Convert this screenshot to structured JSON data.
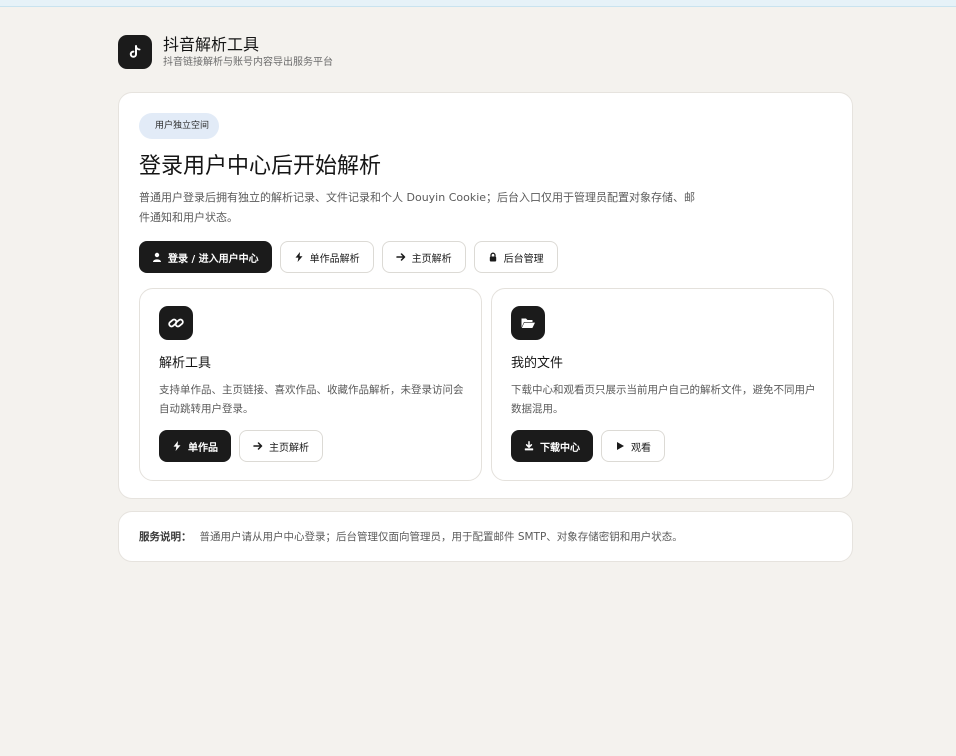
{
  "app": {
    "title": "抖音解析工具",
    "subtitle": "抖音链接解析与账号内容导出服务平台",
    "logo_icon": "tiktok-note-icon"
  },
  "hero": {
    "badge": "用户独立空间",
    "heading": "登录用户中心后开始解析",
    "description": "普通用户登录后拥有独立的解析记录、文件记录和个人 Douyin Cookie；后台入口仅用于管理员配置对象存储、邮件通知和用户状态。",
    "buttons": [
      {
        "label": "登录 / 进入用户中心",
        "icon": "user-icon"
      },
      {
        "label": "单作品解析",
        "icon": "bolt-icon"
      },
      {
        "label": "主页解析",
        "icon": "arrow-right-icon"
      },
      {
        "label": "后台管理",
        "icon": "lock-icon"
      }
    ]
  },
  "cards": [
    {
      "icon": "link-icon",
      "title": "解析工具",
      "description": "支持单作品、主页链接、喜欢作品、收藏作品解析，未登录访问会自动跳转用户登录。",
      "buttons": [
        {
          "label": "单作品",
          "icon": "bolt-icon"
        },
        {
          "label": "主页解析",
          "icon": "arrow-right-icon"
        }
      ]
    },
    {
      "icon": "folder-open-icon",
      "title": "我的文件",
      "description": "下载中心和观看页只展示当前用户自己的解析文件，避免不同用户数据混用。",
      "buttons": [
        {
          "label": "下载中心",
          "icon": "download-icon"
        },
        {
          "label": "观看",
          "icon": "play-icon"
        }
      ]
    }
  ],
  "notice": {
    "label": "服务说明：",
    "text": "普通用户请从用户中心登录；后台管理仅面向管理员，用于配置邮件 SMTP、对象存储密钥和用户状态。"
  },
  "colors": {
    "background": "#f4f2ee",
    "dark": "#1b1b1b",
    "badge_bg": "#e2ebf7"
  }
}
